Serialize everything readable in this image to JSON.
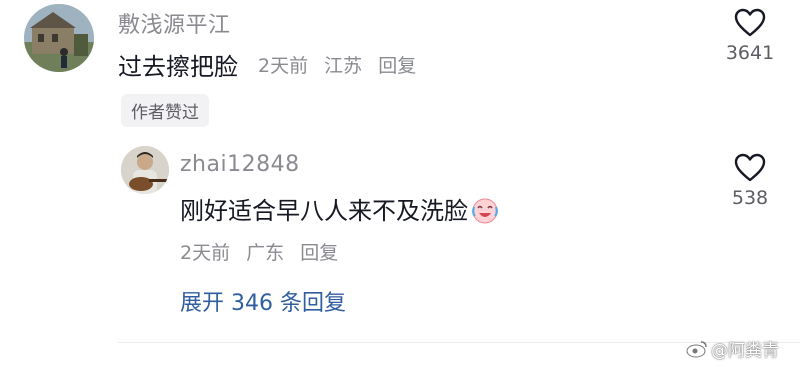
{
  "comment": {
    "username": "敷浅源平江",
    "text": "过去擦把脸",
    "time": "2天前",
    "location": "江苏",
    "reply_label": "回复",
    "badge": "作者赞过",
    "like_count": "3641",
    "like_icon": "heart-outline-icon"
  },
  "reply": {
    "username": "zhai12848",
    "text": "刚好适合早八人来不及洗脸",
    "emoji": "crying-laughing-face-icon",
    "time": "2天前",
    "location": "广东",
    "reply_label": "回复",
    "like_count": "538",
    "like_icon": "heart-outline-icon"
  },
  "expand_label": "展开 346 条回复",
  "watermark": "@阿粪青",
  "colors": {
    "link": "#2f5f9e",
    "meta": "#8a8b91",
    "badge_bg": "#f2f2f4"
  }
}
